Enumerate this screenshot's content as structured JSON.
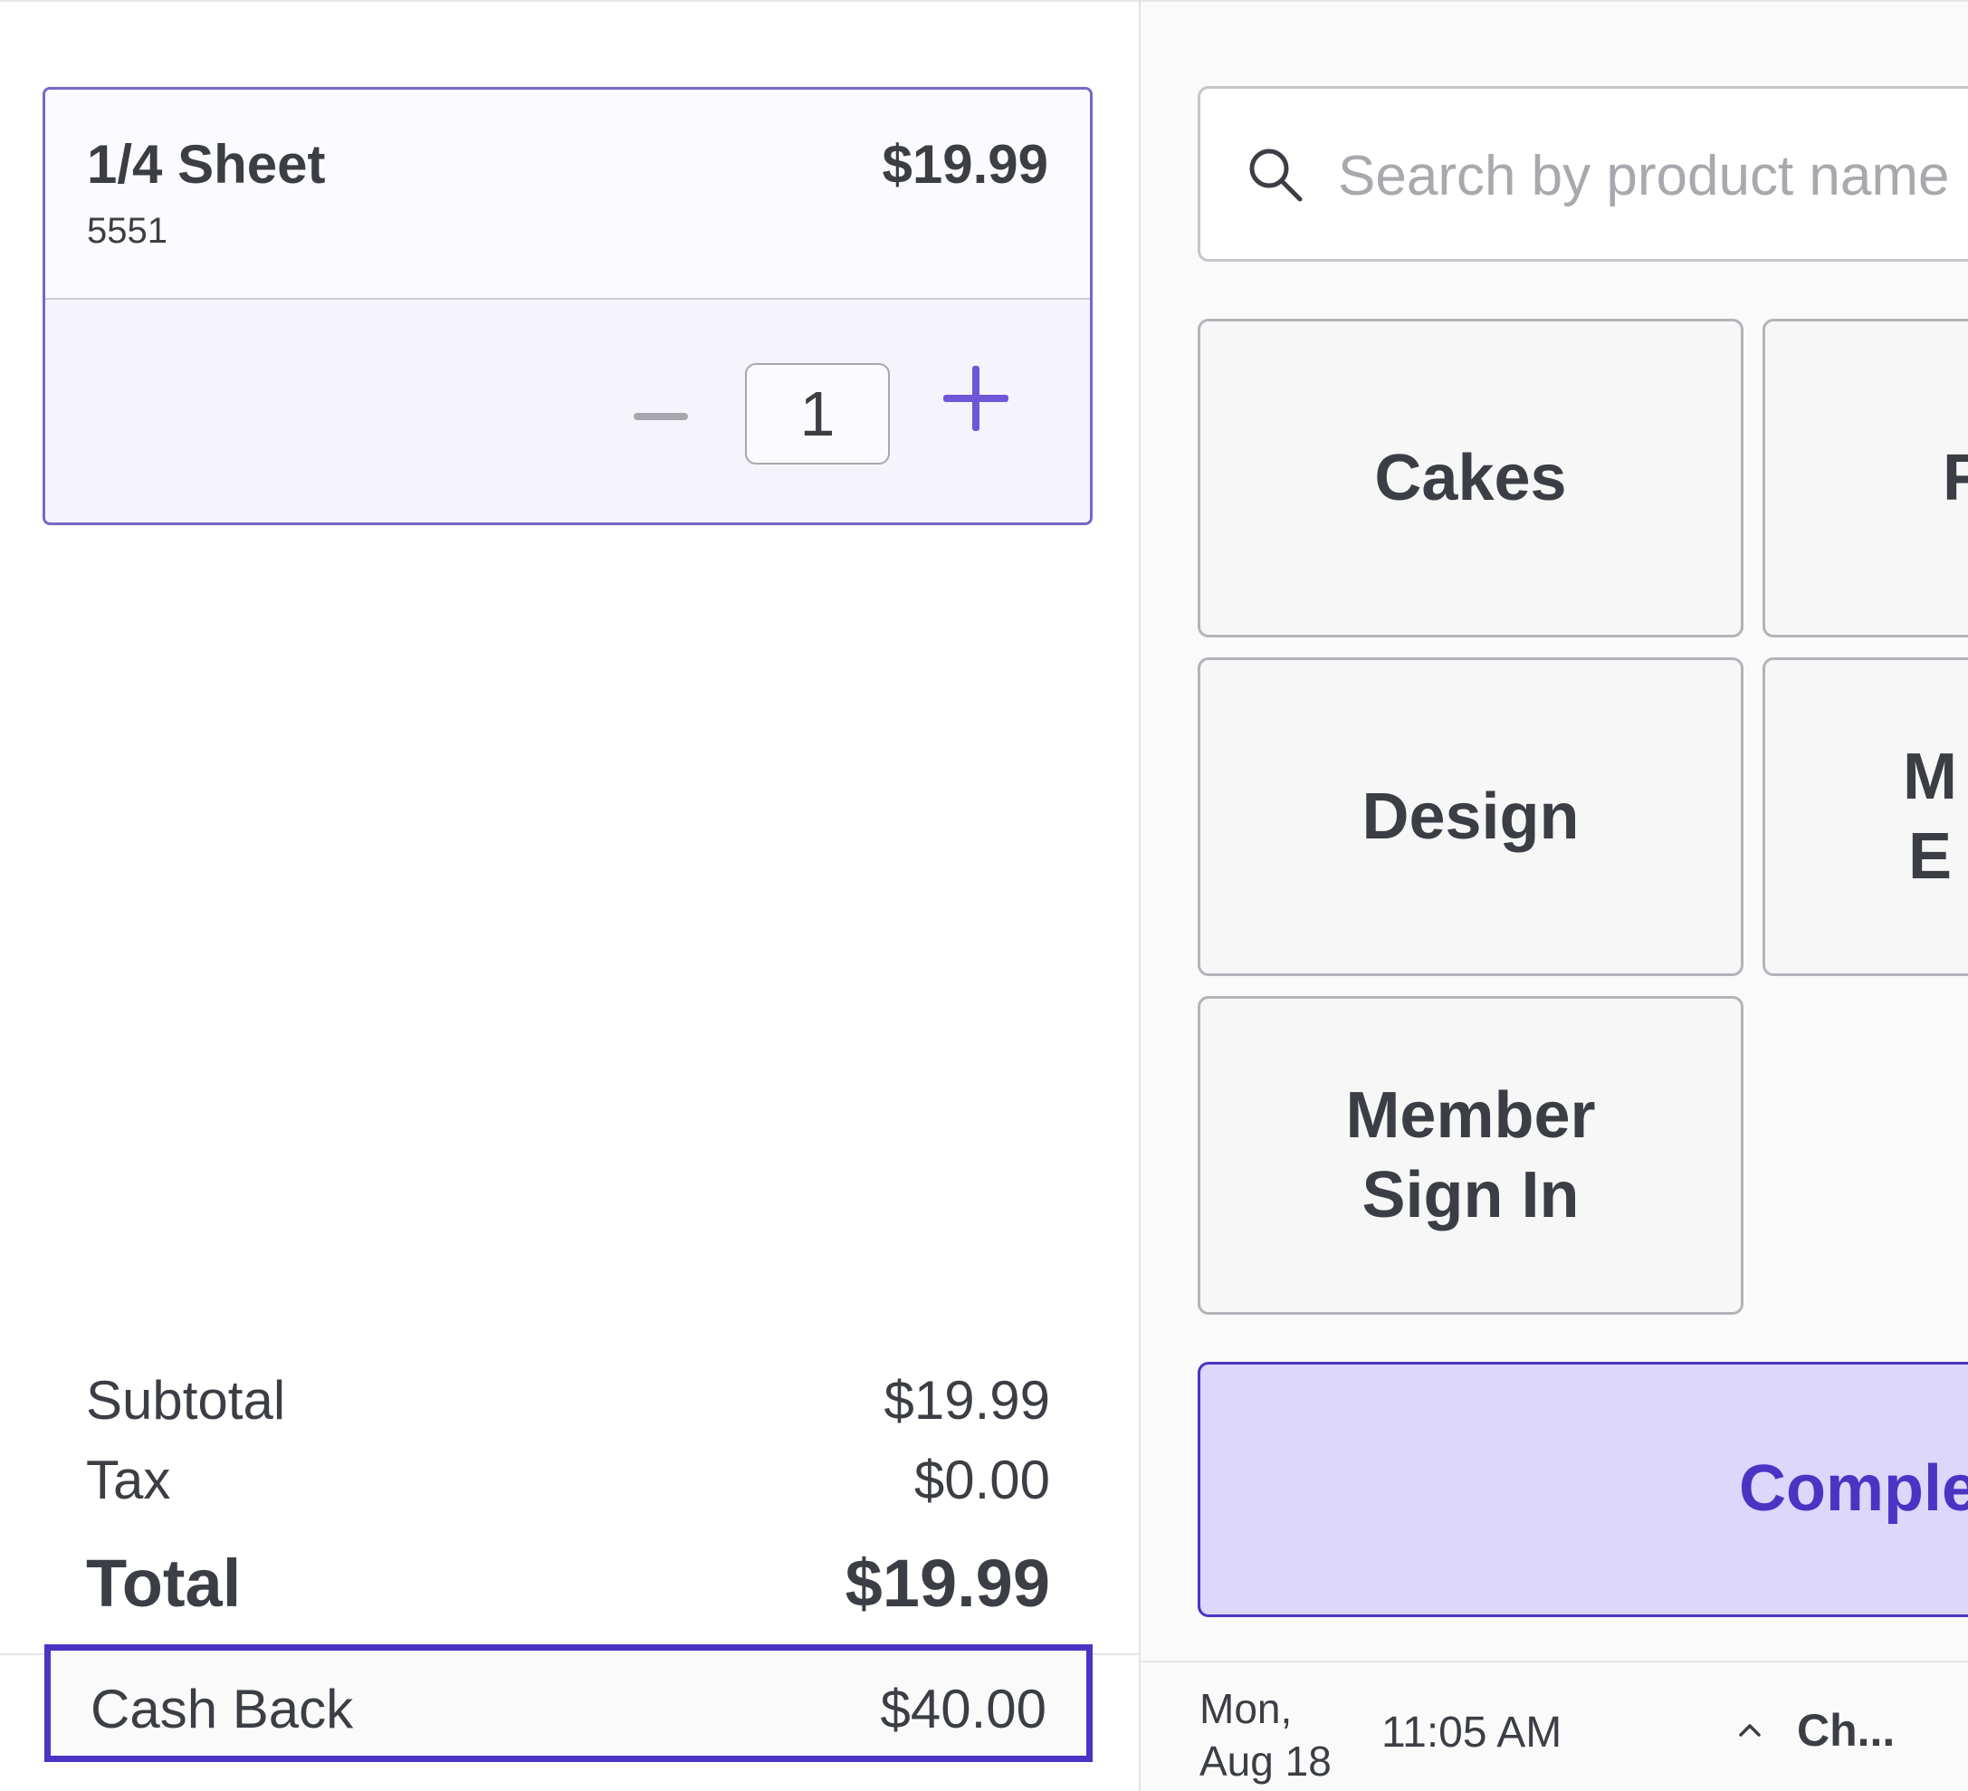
{
  "cart": {
    "items": [
      {
        "name": "1/4 Sheet",
        "sku": "5551",
        "price": "$19.99",
        "quantity": "1"
      }
    ],
    "summary": {
      "subtotal_label": "Subtotal",
      "subtotal_value": "$19.99",
      "tax_label": "Tax",
      "tax_value": "$0.00",
      "total_label": "Total",
      "total_value": "$19.99"
    },
    "cash_back": {
      "label": "Cash Back",
      "value": "$40.00"
    }
  },
  "search": {
    "placeholder": "Search by product name"
  },
  "tiles": {
    "cakes": "Cakes",
    "f_partial": "F",
    "design": "Design",
    "m_partial_line1": "M",
    "m_partial_line2": "E",
    "member_line1": "Member",
    "member_line2": "Sign In"
  },
  "actions": {
    "complete_label": "Complete"
  },
  "status_bar": {
    "day": "Mon,",
    "date": "Aug 18",
    "time": "11:05 AM",
    "truncated_label": "Ch..."
  },
  "icons": {
    "search": "search-icon",
    "caret": "caret-up-icon",
    "plus": "plus-icon",
    "minus": "minus-icon"
  },
  "colors": {
    "accent": "#6f56d8",
    "accent_dark": "#4a34c4",
    "complete_bg": "#dcd7fb",
    "card_border": "#7a66c9"
  }
}
